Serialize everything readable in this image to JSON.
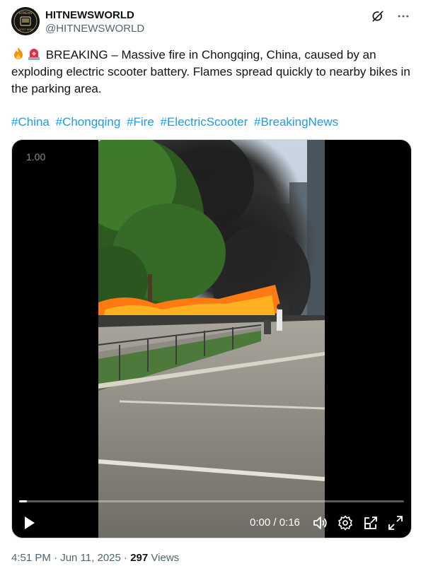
{
  "author": {
    "display_name": "HITNEWSWORLD",
    "handle": "@HITNEWSWORLD",
    "avatar_text": "HITNEWS LATEST NEWS"
  },
  "header_icons": [
    "grok-icon",
    "more-icon"
  ],
  "tweet": {
    "text": "BREAKING – Massive fire in Chongqing, China, caused by an exploding electric scooter battery. Flames spread quickly to nearby bikes in the parking area.",
    "emojis": [
      "fire-emoji",
      "siren-emoji"
    ],
    "hashtags": [
      "#China",
      "#Chongqing",
      "#Fire",
      "#ElectricScooter",
      "#BreakingNews"
    ]
  },
  "video": {
    "speed_label": "1.00",
    "time": "0:00 / 0:16",
    "progress": 0.02,
    "controls": [
      "play-icon",
      "volume-icon",
      "settings-icon",
      "pip-icon",
      "fullscreen-icon"
    ]
  },
  "meta": {
    "time": "4:51 PM",
    "date": "Jun 11, 2025",
    "separator": "·",
    "views_count": "297",
    "views_label": "Views"
  },
  "colors": {
    "link": "#1d9bf0",
    "text": "#0f1419",
    "secondary": "#536471"
  }
}
